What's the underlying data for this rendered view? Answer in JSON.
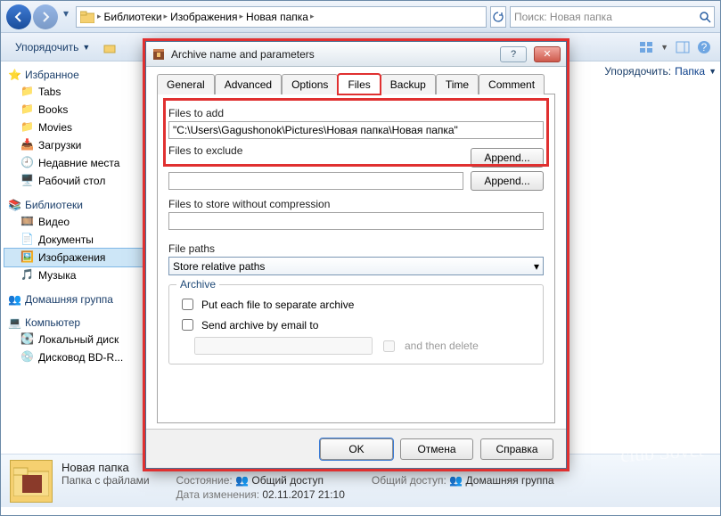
{
  "explorer": {
    "breadcrumbs": [
      "Библиотеки",
      "Изображения",
      "Новая папка"
    ],
    "search_placeholder": "Поиск: Новая папка",
    "toolbar": {
      "organize": "Упорядочить"
    },
    "right_pane": {
      "sort_label": "Упорядочить:",
      "sort_value": "Папка"
    },
    "sidebar": {
      "favorites": {
        "title": "Избранное",
        "items": [
          "Tabs",
          "Books",
          "Movies",
          "Загрузки",
          "Недавние места",
          "Рабочий стол"
        ]
      },
      "libraries": {
        "title": "Библиотеки",
        "items": [
          "Видео",
          "Документы",
          "Изображения",
          "Музыка"
        ]
      },
      "homegroup": {
        "title": "Домашняя группа"
      },
      "computer": {
        "title": "Компьютер",
        "items": [
          "Локальный диск",
          "Дисковод BD-R..."
        ]
      }
    },
    "status": {
      "folder_name": "Новая папка",
      "type_line": "Папка с файлами",
      "state_label": "Состояние:",
      "state_value": "Общий доступ",
      "date_label": "Дата изменения:",
      "date_value": "02.11.2017 21:10",
      "shared_label": "Общий доступ:",
      "shared_value": "Домашняя группа"
    }
  },
  "dialog": {
    "title": "Archive name and parameters",
    "tabs": [
      "General",
      "Advanced",
      "Options",
      "Files",
      "Backup",
      "Time",
      "Comment"
    ],
    "active_tab": "Files",
    "files": {
      "add_label": "Files to add",
      "add_value": "\"C:\\Users\\Gagushonok\\Pictures\\Новая папка\\Новая папка\"",
      "exclude_label": "Files to exclude",
      "exclude_value": "",
      "nocmp_label": "Files to store without compression",
      "nocmp_value": "",
      "paths_label": "File paths",
      "paths_value": "Store relative paths",
      "append": "Append...",
      "group_title": "Archive",
      "chk_separate": "Put each file to separate archive",
      "chk_email": "Send archive by email to",
      "email_value": "",
      "then_delete": "and then delete"
    },
    "buttons": {
      "ok": "OK",
      "cancel": "Отмена",
      "help": "Справка"
    }
  },
  "watermark": "club Sovet"
}
